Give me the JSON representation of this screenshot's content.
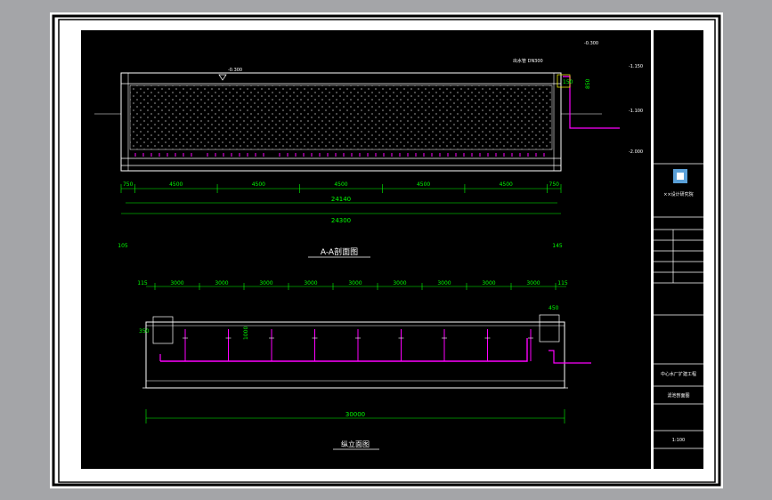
{
  "sections": {
    "a_a_title": "A-A剖面图",
    "plan_title": "纵立面图"
  },
  "levels": {
    "water_top": "-0.300",
    "right_top": "-0.300",
    "right_1": "-1.150",
    "right_2": "-1.100",
    "right_3": "-2.000",
    "side_note": "出水管 DN300"
  },
  "dims_top": {
    "segments": [
      "750",
      "4500",
      "4500",
      "4500",
      "4500",
      "4500",
      "750"
    ],
    "total_inner": "24140",
    "total_outer": "24300",
    "left_edge": "105",
    "right_edge": "145",
    "vertical_right": "850",
    "vertical_right2": "150"
  },
  "dims_bottom": {
    "edge_left": "115",
    "edge_right": "115",
    "segments": [
      "3000",
      "3000",
      "3000",
      "3000",
      "3000",
      "3000",
      "3000",
      "3000",
      "3000"
    ],
    "total": "30000",
    "left_height": "350",
    "center_height": "1000",
    "right_top": "450"
  },
  "title_block": {
    "company": "××设计研究院",
    "project": "中心水厂扩建工程",
    "drawing": "滤池剖面图",
    "scale": "1:100"
  },
  "colors": {
    "background": "#000000",
    "lines": "#ffffff",
    "dimensions": "#00ff00",
    "pipes": "#ff00ff",
    "accent": "#ffff00"
  }
}
